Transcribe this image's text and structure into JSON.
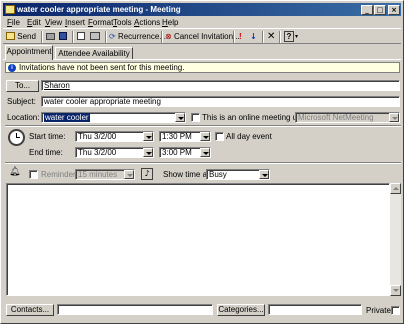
{
  "window": {
    "title": "water cooler appropriate meeting - Meeting",
    "minimize": "_",
    "maximize": "□",
    "close": "×"
  },
  "menu": [
    "File",
    "Edit",
    "View",
    "Insert",
    "Format",
    "Tools",
    "Actions",
    "Help"
  ],
  "toolbar": {
    "send": "Send",
    "recurrence": "Recurrence...",
    "cancel_invitation": "Cancel Invitation...",
    "importance_high": "!",
    "importance_low": "↓",
    "help": "?"
  },
  "tabs": [
    "Appointment",
    "Attendee Availability"
  ],
  "info_bar": {
    "icon": "i",
    "text": "Invitations have not been sent for this meeting."
  },
  "to": {
    "button": "To...",
    "value": "Sharon"
  },
  "subject": {
    "label": "Subject:",
    "value": "water cooler appropriate meeting"
  },
  "location": {
    "label": "Location:",
    "value": "water cooler",
    "online_label": "This is an online meeting using:",
    "online_value": "Microsoft NetMeeting"
  },
  "start": {
    "label": "Start time:",
    "date": "Thu 3/2/00",
    "time": "1:30 PM"
  },
  "end": {
    "label": "End time:",
    "date": "Thu 3/2/00",
    "time": "3:00 PM"
  },
  "all_day_label": "All day event",
  "reminder": {
    "label": "Reminder:",
    "value": "15 minutes"
  },
  "show_time_as": {
    "label": "Show time as:",
    "value": "Busy"
  },
  "footer": {
    "contacts": "Contacts...",
    "categories": "Categories...",
    "private": "Private"
  }
}
